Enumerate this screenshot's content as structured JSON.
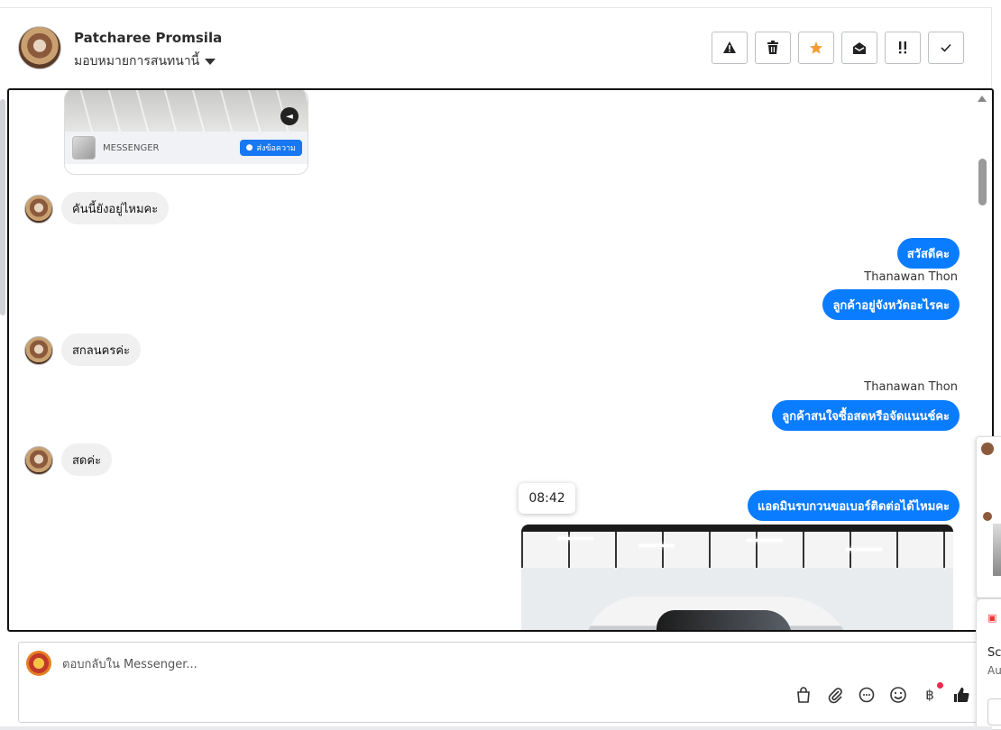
{
  "header": {
    "contact_name": "Patcharee Promsila",
    "assign_label": "มอบหมายการสนทนานี้",
    "actions": [
      {
        "name": "report-spam-button",
        "icon": "warning-icon"
      },
      {
        "name": "delete-button",
        "icon": "trash-icon"
      },
      {
        "name": "star-button",
        "icon": "star-icon"
      },
      {
        "name": "mark-unread-button",
        "icon": "envelope-open-icon"
      },
      {
        "name": "follow-up-button",
        "icon": "exclamation-icon"
      },
      {
        "name": "mark-done-button",
        "icon": "check-icon"
      }
    ],
    "accent_star": "#f29c38"
  },
  "thread": {
    "ad_card": {
      "source": "MESSENGER",
      "cta": "ส่งข้อความ"
    },
    "messages": [
      {
        "dir": "in",
        "text": "คันนี้ยังอยู่ไหมคะ"
      },
      {
        "dir": "out",
        "text": "สวัสดีคะ"
      },
      {
        "dir": "out",
        "sender": "Thanawan Thon",
        "text": "ลูกค้าอยู่จังหวัดอะไรคะ"
      },
      {
        "dir": "in",
        "text": "สกลนครค่ะ"
      },
      {
        "dir": "out",
        "sender": "Thanawan Thon",
        "text": "ลูกค้าสนใจซื้อสดหรือจัดแนนช์คะ"
      },
      {
        "dir": "in",
        "text": "สดค่ะ"
      },
      {
        "dir": "out",
        "text": "แอดมินรบกวนขอเบอร์ติดต่อได้ไหมคะ",
        "time_tooltip": "08:42"
      }
    ],
    "bubble_color": "#0a7cff"
  },
  "composer": {
    "placeholder": "ตอบกลับใน Messenger...",
    "tools": [
      "shopping-bag-icon",
      "paperclip-icon",
      "chat-bubble-icon",
      "emoji-icon",
      "baht-icon",
      "thumbs-up-icon"
    ]
  },
  "side_peek": {
    "title_fragment": "Sc",
    "subtitle_fragment": "Au"
  }
}
